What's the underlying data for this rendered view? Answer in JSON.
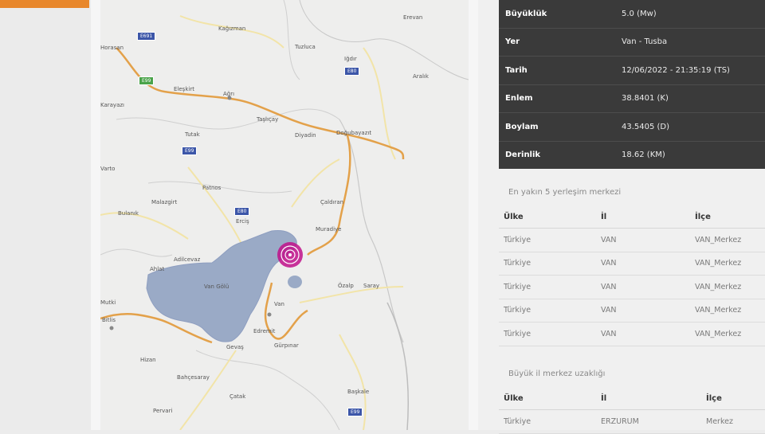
{
  "info": {
    "rows": [
      {
        "key": "Büyüklük",
        "value": "5.0 (Mw)"
      },
      {
        "key": "Yer",
        "value": "Van - Tusba"
      },
      {
        "key": "Tarih",
        "value": "12/06/2022 - 21:35:19 (TS)"
      },
      {
        "key": "Enlem",
        "value": "38.8401 (K)"
      },
      {
        "key": "Boylam",
        "value": "43.5405 (D)"
      },
      {
        "key": "Derinlik",
        "value": "18.62 (KM)"
      }
    ]
  },
  "nearest": {
    "title": "En yakın 5 yerleşim merkezi",
    "headers": {
      "country": "Ülke",
      "province": "İl",
      "district": "İlçe"
    },
    "rows": [
      {
        "country": "Türkiye",
        "province": "VAN",
        "district": "VAN_Merkez"
      },
      {
        "country": "Türkiye",
        "province": "VAN",
        "district": "VAN_Merkez"
      },
      {
        "country": "Türkiye",
        "province": "VAN",
        "district": "VAN_Merkez"
      },
      {
        "country": "Türkiye",
        "province": "VAN",
        "district": "VAN_Merkez"
      },
      {
        "country": "Türkiye",
        "province": "VAN",
        "district": "VAN_Merkez"
      }
    ]
  },
  "big_cities": {
    "title": "Büyük il merkez uzaklığı",
    "headers": {
      "country": "Ülke",
      "province": "İl",
      "district": "İlçe"
    },
    "rows": [
      {
        "country": "Türkiye",
        "province": "ERZURUM",
        "district": "Merkez"
      }
    ]
  },
  "map": {
    "lake_label": "Van Gölü",
    "places": {
      "erevan": "Erevan",
      "kagizman": "Kağızman",
      "tuzluca": "Tuzluca",
      "igdir": "Iğdır",
      "aralik": "Aralık",
      "horasan": "Horasan",
      "eleskirt": "Eleşkirt",
      "agri": "Ağrı",
      "karayazi": "Karayazı",
      "taslicay": "Taşlıçay",
      "dogubayazit": "Doğubayazıt",
      "diyadin": "Diyadin",
      "tutak": "Tutak",
      "varto": "Varto",
      "patnos": "Patnos",
      "caldiran": "Çaldıran",
      "malazgirt": "Malazgirt",
      "bulanik": "Bulanık",
      "ercis": "Erciş",
      "muradiye": "Muradiye",
      "adilcevaz": "Adilcevaz",
      "ahlat": "Ahlat",
      "ozalp": "Özalp",
      "saray": "Saray",
      "van": "Van",
      "bitlis": "Bitlis",
      "edremit": "Edremit",
      "gevas": "Gevaş",
      "gurpinar": "Gürpınar",
      "hizan": "Hizan",
      "bahcesaray": "Bahçesaray",
      "catak": "Çatak",
      "pervari": "Pervari",
      "baskale": "Başkale",
      "mutki": "Mutki"
    },
    "signs": [
      "E691",
      "E99",
      "E80",
      "E99",
      "E80",
      "E99"
    ],
    "accent_colors": {
      "road": "#e3a14a",
      "lake": "#9aaac6",
      "marker": "#c0108a",
      "table_bg": "#3a3a3a"
    }
  }
}
